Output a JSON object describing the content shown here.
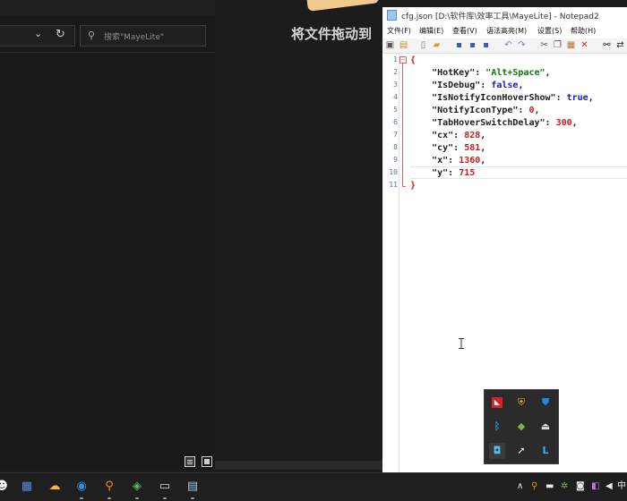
{
  "explorer": {
    "search_placeholder": "搜索\"MayeLite\"",
    "view_buttons": [
      "details-view",
      "large-icons-view"
    ]
  },
  "overlay": {
    "banner_text": "将文件拖动到"
  },
  "notepad": {
    "title": "cfg.json [D:\\软件库\\效率工具\\MayeLite] - Notepad2",
    "menu": [
      "文件(F)",
      "编辑(E)",
      "查看(V)",
      "语法高亮(M)",
      "设置(S)",
      "帮助(H)"
    ],
    "line_numbers": [
      "1",
      "2",
      "3",
      "4",
      "5",
      "6",
      "7",
      "8",
      "9",
      "10",
      "11"
    ],
    "lines": [
      {
        "parts": [
          [
            "brace",
            "{"
          ]
        ]
      },
      {
        "parts": [
          [
            "key",
            "    \"HotKey\""
          ],
          [
            "punct",
            ": "
          ],
          [
            "str",
            "\"Alt+Space\""
          ],
          [
            "punct",
            ","
          ]
        ]
      },
      {
        "parts": [
          [
            "key",
            "    \"IsDebug\""
          ],
          [
            "punct",
            ": "
          ],
          [
            "bool",
            "false"
          ],
          [
            "punct",
            ","
          ]
        ]
      },
      {
        "parts": [
          [
            "key",
            "    \"IsNotifyIconHoverShow\""
          ],
          [
            "punct",
            ": "
          ],
          [
            "bool",
            "true"
          ],
          [
            "punct",
            ","
          ]
        ]
      },
      {
        "parts": [
          [
            "key",
            "    \"NotifyIconType\""
          ],
          [
            "punct",
            ": "
          ],
          [
            "num",
            "0"
          ],
          [
            "punct",
            ","
          ]
        ]
      },
      {
        "parts": [
          [
            "key",
            "    \"TabHoverSwitchDelay\""
          ],
          [
            "punct",
            ": "
          ],
          [
            "num",
            "300"
          ],
          [
            "punct",
            ","
          ]
        ]
      },
      {
        "parts": [
          [
            "key",
            "    \"cx\""
          ],
          [
            "punct",
            ": "
          ],
          [
            "num",
            "828"
          ],
          [
            "punct",
            ","
          ]
        ]
      },
      {
        "parts": [
          [
            "key",
            "    \"cy\""
          ],
          [
            "punct",
            ": "
          ],
          [
            "num",
            "581"
          ],
          [
            "punct",
            ","
          ]
        ]
      },
      {
        "parts": [
          [
            "key",
            "    \"x\""
          ],
          [
            "punct",
            ": "
          ],
          [
            "num",
            "1360"
          ],
          [
            "punct",
            ","
          ]
        ]
      },
      {
        "parts": [
          [
            "key",
            "    \"y\""
          ],
          [
            "punct",
            ": "
          ],
          [
            "num",
            "715"
          ]
        ]
      },
      {
        "parts": [
          [
            "brace",
            "}"
          ]
        ]
      }
    ],
    "current_line": 10
  },
  "tray_popup": {
    "icons": [
      "amd-icon",
      "shield-icon",
      "defender-icon",
      "bluetooth-icon",
      "network-app-icon",
      "usb-eject-icon",
      "mayelite-icon",
      "pointer-icon",
      "app-l-icon"
    ]
  },
  "taskbar": {
    "apps": [
      "qq-icon",
      "calculator-icon",
      "weather-icon",
      "browser-icon",
      "search-tool-icon",
      "network-tool-icon",
      "remote-desktop-icon",
      "notepad2-icon"
    ],
    "ime_label": "中"
  },
  "colors": {
    "accent": "#0078d4",
    "json_string": "#0a7a0a",
    "json_bool": "#1818c8",
    "json_number": "#d01818"
  }
}
